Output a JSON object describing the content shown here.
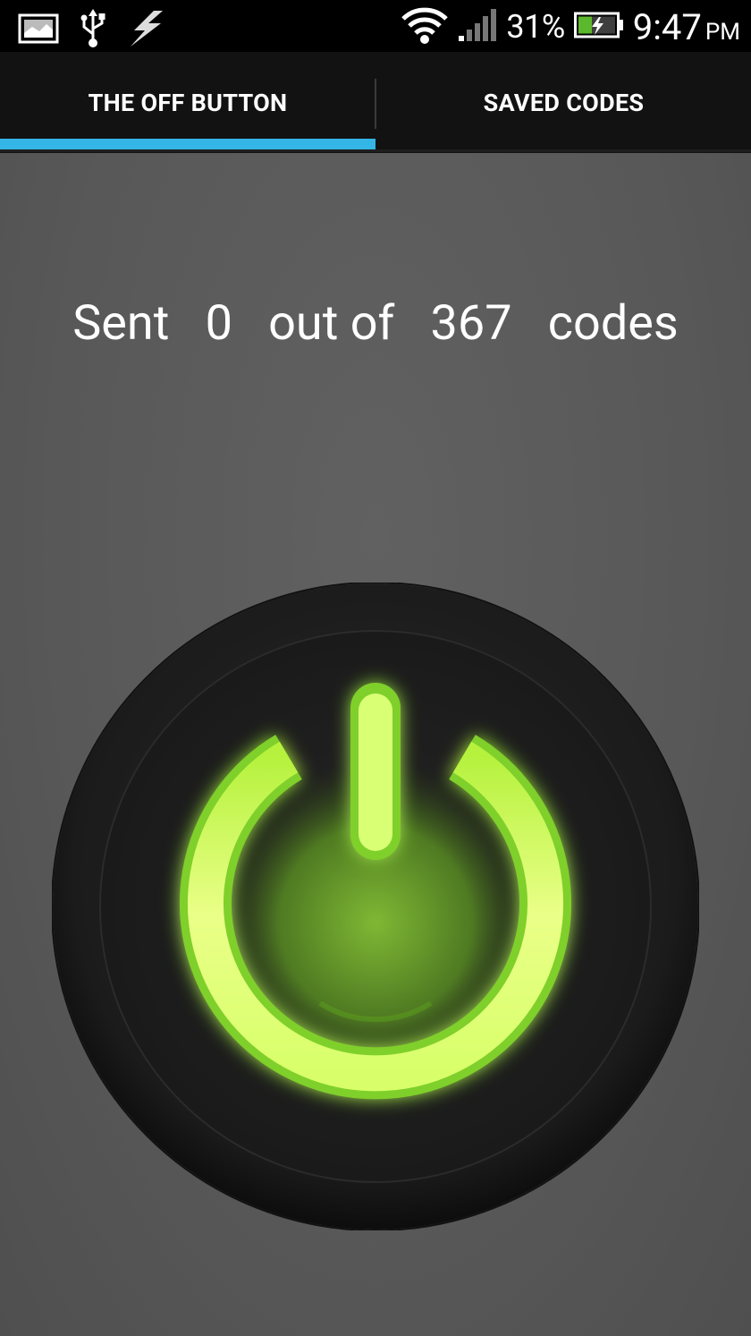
{
  "status_bar": {
    "battery_percent": "31%",
    "time": "9:47",
    "ampm": "PM",
    "icons": [
      "image-notification-icon",
      "usb-icon",
      "lightning-icon",
      "wifi-icon",
      "signal-icon",
      "battery-charging-icon"
    ]
  },
  "tabs": [
    {
      "label": "THE OFF BUTTON",
      "selected": true
    },
    {
      "label": "SAVED CODES",
      "selected": false
    }
  ],
  "progress": {
    "prefix": "Sent",
    "sent": "0",
    "middle": "out of",
    "total": "367",
    "suffix": "codes"
  },
  "colors": {
    "accent": "#33b5e5",
    "power_glow": "#a8ff3a",
    "background": "#5a5a5a"
  }
}
